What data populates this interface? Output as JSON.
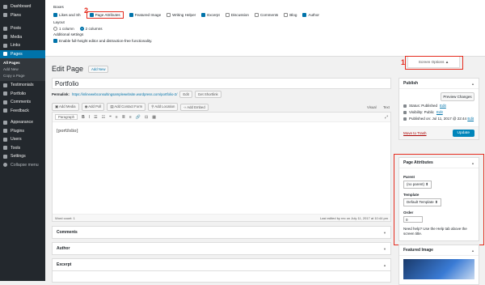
{
  "sidebar": {
    "items": [
      {
        "label": "Dashboard",
        "icon": "dashboard-icon"
      },
      {
        "label": "Plans",
        "icon": "plans-icon"
      },
      {
        "label": "Posts",
        "icon": "pin-icon"
      },
      {
        "label": "Media",
        "icon": "media-icon"
      },
      {
        "label": "Links",
        "icon": "link-icon"
      },
      {
        "label": "Pages",
        "icon": "page-icon",
        "active": true
      },
      {
        "label": "Testimonials",
        "icon": "testimonial-icon"
      },
      {
        "label": "Portfolio",
        "icon": "portfolio-icon"
      },
      {
        "label": "Comments",
        "icon": "comment-icon"
      },
      {
        "label": "Feedback",
        "icon": "feedback-icon"
      },
      {
        "label": "Appearance",
        "icon": "appearance-icon"
      },
      {
        "label": "Plugins",
        "icon": "plugin-icon"
      },
      {
        "label": "Users",
        "icon": "user-icon"
      },
      {
        "label": "Tools",
        "icon": "tool-icon"
      },
      {
        "label": "Settings",
        "icon": "settings-icon"
      },
      {
        "label": "Collapse menu",
        "icon": "collapse-icon"
      }
    ],
    "subitems": [
      "All Pages",
      "Add New",
      "Copy a Page"
    ]
  },
  "screen_options": {
    "boxes_heading": "Boxes",
    "boxes": [
      {
        "label": "Likes and Sh",
        "checked": true
      },
      {
        "label": "Page Attributes",
        "checked": true
      },
      {
        "label": "Featured Image",
        "checked": true
      },
      {
        "label": "Writing Helper",
        "checked": false
      },
      {
        "label": "Excerpt",
        "checked": true
      },
      {
        "label": "Discussion",
        "checked": false
      },
      {
        "label": "Comments",
        "checked": false
      },
      {
        "label": "Blog",
        "checked": false
      },
      {
        "label": "Author",
        "checked": true
      }
    ],
    "layout_heading": "Layout",
    "layout_options": [
      {
        "label": "1 column",
        "checked": false
      },
      {
        "label": "2 columns",
        "checked": true
      }
    ],
    "additional_heading": "Additional settings",
    "additional_label": "Enable full-height editor and distraction-free functionality.",
    "toggle_label": "Screen Options ▲"
  },
  "markers": {
    "one": "1",
    "two": "2"
  },
  "editor": {
    "page_title": "Edit Page",
    "add_new": "Add New",
    "title_value": "Portfolio",
    "permalink_label": "Permalink:",
    "permalink_url": "https://inlinewebconsultingsamplewebsite.wordpress.com/portfolio-2/",
    "edit_btn": "Edit",
    "shortlink_btn": "Get Shortlink",
    "media_buttons": [
      "Add Media",
      "Add Poll",
      "Add Contact Form",
      "Add Location",
      "Add Embed"
    ],
    "tab_visual": "Visual",
    "tab_text": "Text",
    "format_select": "Paragraph",
    "toolbar_glyphs": [
      "B",
      "I",
      "☰",
      "☷",
      "❝",
      "≡",
      "≣",
      "≡",
      "🔗",
      "⊟",
      "▦"
    ],
    "content": "[portfolio]",
    "word_count": "Word count: 1",
    "last_edited": "Last edited by rec on July 11, 2017 at 10:44 pm"
  },
  "boxes_below": [
    {
      "title": "Comments",
      "arrow": "▼"
    },
    {
      "title": "Author",
      "arrow": "▼"
    },
    {
      "title": "Excerpt",
      "arrow": "▲"
    }
  ],
  "publish": {
    "title": "Publish",
    "preview": "Preview Changes",
    "status": "Status: Published",
    "visibility": "Visibility: Public",
    "published_on": "Published on: Jul 11, 2017 @ 22:44",
    "edit": "Edit",
    "trash": "Move to Trash",
    "update": "Update"
  },
  "page_attributes": {
    "title": "Page Attributes",
    "parent_label": "Parent",
    "parent_value": "(no parent)",
    "template_label": "Template",
    "template_value": "Default Template",
    "order_label": "Order",
    "order_value": "0",
    "help": "Need help? Use the Help tab above the screen title."
  },
  "featured_image": {
    "title": "Featured Image"
  },
  "colors": {
    "accent": "#0073aa",
    "sidebar": "#23282d",
    "highlight": "#e52b1e"
  }
}
